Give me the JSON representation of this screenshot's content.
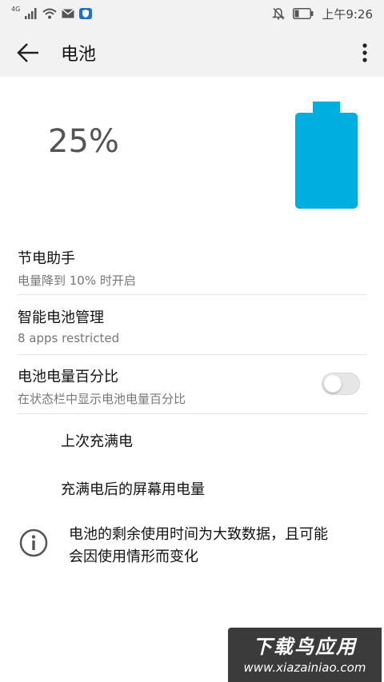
{
  "status_bar": {
    "network_label": "4G",
    "time": "上午9:26"
  },
  "app_bar": {
    "title": "电池"
  },
  "battery": {
    "percent_text": "25%",
    "level": 0.25,
    "color": "#00aee0"
  },
  "settings": [
    {
      "title": "节电助手",
      "subtitle": "电量降到 10% 时开启"
    },
    {
      "title": "智能电池管理",
      "subtitle": "8 apps restricted"
    },
    {
      "title": "电池电量百分比",
      "subtitle": "在状态栏中显示电池电量百分比",
      "toggle_on": false
    }
  ],
  "links": [
    {
      "label": "上次充满电"
    },
    {
      "label": "充满电后的屏幕用电量"
    }
  ],
  "info": {
    "line1": "电池的剩余使用时间为大致数据，且可能",
    "line2": "会因使用情形而变化"
  },
  "watermark": {
    "brand": "下载鸟应用",
    "url": "www.xiazainiao.com"
  }
}
